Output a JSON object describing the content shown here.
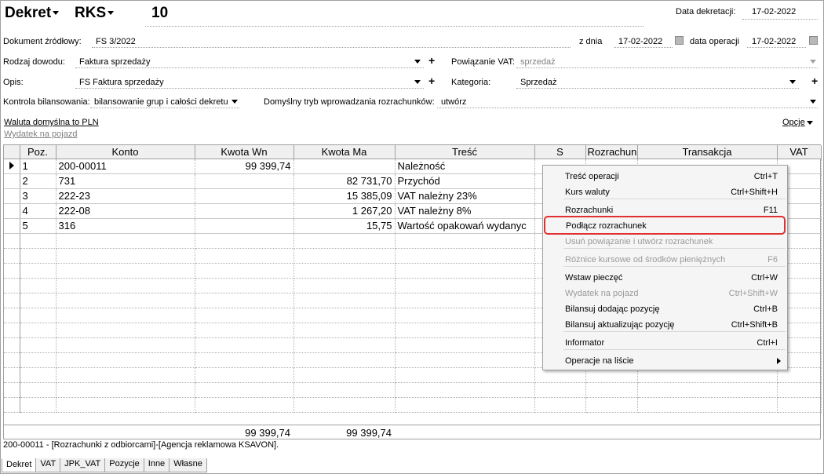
{
  "header": {
    "doc_type": "Dekret",
    "register": "RKS",
    "number": "10",
    "decree_date_label": "Data dekretacji:",
    "decree_date": "17-02-2022"
  },
  "fields": {
    "source_doc_label": "Dokument źródłowy:",
    "source_doc": "FS 3/2022",
    "of_day_label": "z dnia",
    "of_day": "17-02-2022",
    "op_date_label": "data operacji",
    "op_date": "17-02-2022",
    "proof_type_label": "Rodzaj dowodu:",
    "proof_type": "Faktura sprzedaży",
    "vat_link_label": "Powiązanie VAT:",
    "vat_link": "sprzedaż",
    "desc_label": "Opis:",
    "desc": "FS Faktura sprzedaży",
    "category_label": "Kategoria:",
    "category": "Sprzedaż",
    "balance_label": "Kontrola bilansowania:",
    "balance": "bilansowanie grup i całości dekretu",
    "settle_mode_label": "Domyślny tryb wprowadzania rozrachunków:",
    "settle_mode": "utwórz",
    "plus": "+"
  },
  "links": {
    "currency": "Waluta domyślna to PLN",
    "vehicle": "Wydatek na pojazd",
    "options": "Opcje"
  },
  "table": {
    "columns": [
      "Poz.",
      "Konto",
      "Kwota Wn",
      "Kwota Ma",
      "Treść",
      "S",
      "Rozrachun",
      "Transakcja",
      "VAT"
    ],
    "rows": [
      {
        "poz": "1",
        "konto": "200-00011",
        "wn": "99 399,74",
        "ma": "",
        "tresc": "Należność",
        "s": "",
        "roz": "",
        "trans": "",
        "vat": ""
      },
      {
        "poz": "2",
        "konto": "731",
        "wn": "",
        "ma": "82 731,70",
        "tresc": "Przychód",
        "s": "",
        "roz": "",
        "trans": "",
        "vat": ""
      },
      {
        "poz": "3",
        "konto": "222-23",
        "wn": "",
        "ma": "15 385,09",
        "tresc": "VAT należny 23%",
        "s": "",
        "roz": "",
        "trans": "",
        "vat": ""
      },
      {
        "poz": "4",
        "konto": "222-08",
        "wn": "",
        "ma": "1 267,20",
        "tresc": "VAT należny 8%",
        "s": "",
        "roz": "",
        "trans": "",
        "vat": ""
      },
      {
        "poz": "5",
        "konto": "316",
        "wn": "",
        "ma": "15,75",
        "tresc": "Wartość opakowań wydanyc",
        "s": "",
        "roz": "",
        "trans": "",
        "vat": ""
      }
    ],
    "sum_wn": "99 399,74",
    "sum_ma": "99 399,74"
  },
  "status_text": "200-00011 - [Rozrachunki z odbiorcami]-[Agencja reklamowa KSAVON].",
  "tabs": [
    "Dekret",
    "VAT",
    "JPK_VAT",
    "Pozycje",
    "Inne",
    "Własne"
  ],
  "menu": [
    {
      "label": "Treść operacji",
      "shortcut": "Ctrl+T",
      "disabled": false
    },
    {
      "label": "Kurs waluty",
      "shortcut": "Ctrl+Shift+H",
      "disabled": false
    },
    {
      "label": "Rozrachunki",
      "shortcut": "F11",
      "disabled": false
    },
    {
      "label": "Podłącz rozrachunek",
      "shortcut": "",
      "disabled": false,
      "highlighted": true
    },
    {
      "label": "Usuń powiązanie i utwórz rozrachunek",
      "shortcut": "",
      "disabled": true
    },
    {
      "label": "Różnice kursowe od środków pieniężnych",
      "shortcut": "F6",
      "disabled": true
    },
    {
      "label": "Wstaw pieczęć",
      "shortcut": "Ctrl+W",
      "disabled": false
    },
    {
      "label": "Wydatek na pojazd",
      "shortcut": "Ctrl+Shift+W",
      "disabled": true
    },
    {
      "label": "Bilansuj dodając pozycję",
      "shortcut": "Ctrl+B",
      "disabled": false
    },
    {
      "label": "Bilansuj aktualizując pozycję",
      "shortcut": "Ctrl+Shift+B",
      "disabled": false
    },
    {
      "label": "Informator",
      "shortcut": "Ctrl+I",
      "disabled": false
    },
    {
      "label": "Operacje na liście",
      "shortcut": "",
      "disabled": false,
      "submenu": true
    }
  ],
  "colors": {
    "highlight_border": "#e03030",
    "disabled_text": "#9a9a9a",
    "header_bg": "#f0f0f0"
  }
}
